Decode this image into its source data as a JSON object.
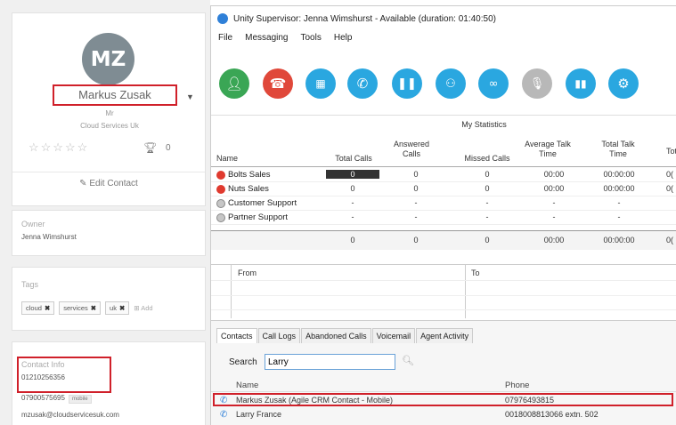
{
  "crm": {
    "avatar_initials": "MZ",
    "contact_name": "Markus Zusak",
    "salutation": "Mr",
    "company": "Cloud Services Uk",
    "stars": "☆☆☆☆☆",
    "score": "0",
    "edit_label": "Edit Contact",
    "owner_label": "Owner",
    "owner_value": "Jenna Wimshurst",
    "tags_label": "Tags",
    "tags": [
      "cloud",
      "services",
      "uk"
    ],
    "tag_add": "Add",
    "contact_info_label": "Contact Info",
    "phone1": "01210256356",
    "phone2": "07900575695",
    "phone2_badge": "mobile",
    "email": "mzusak@cloudservicesuk.com"
  },
  "unity": {
    "title": "Unity Supervisor: Jenna Wimshurst - Available (duration: 01:40:50)",
    "menu": [
      "File",
      "Messaging",
      "Tools",
      "Help"
    ],
    "toolbar_buttons": [
      {
        "name": "agent-status-icon",
        "color": "#3aa655"
      },
      {
        "name": "hangup-icon",
        "color": "#e0483a"
      },
      {
        "name": "dialpad-icon",
        "color": "#2aa7e0"
      },
      {
        "name": "transfer-call-icon",
        "color": "#2aa7e0"
      },
      {
        "name": "pause-icon",
        "color": "#2aa7e0"
      },
      {
        "name": "conference-icon",
        "color": "#2aa7e0"
      },
      {
        "name": "voicemail-icon",
        "color": "#2aa7e0"
      },
      {
        "name": "microphone-icon",
        "color": "#b8b8b8"
      },
      {
        "name": "statistics-icon",
        "color": "#2aa7e0"
      },
      {
        "name": "settings-icon",
        "color": "#2aa7e0"
      }
    ],
    "stats": {
      "title": "My Statistics",
      "columns": [
        "Name",
        "Total Calls",
        "Answered Calls",
        "Missed Calls",
        "Average Talk Time",
        "Total Talk Time",
        "Tot"
      ],
      "rows": [
        {
          "name": "Bolts Sales",
          "status": "red",
          "total": "0",
          "answered": "0",
          "missed": "0",
          "avg": "00:00",
          "talk": "00:00:00",
          "tot": "0("
        },
        {
          "name": "Nuts Sales",
          "status": "red",
          "total": "0",
          "answered": "0",
          "missed": "0",
          "avg": "00:00",
          "talk": "00:00:00",
          "tot": "0("
        },
        {
          "name": "Customer Support",
          "status": "grey",
          "total": "-",
          "answered": "-",
          "missed": "-",
          "avg": "-",
          "talk": "-",
          "tot": ""
        },
        {
          "name": "Partner Support",
          "status": "grey",
          "total": "-",
          "answered": "-",
          "missed": "-",
          "avg": "-",
          "talk": "-",
          "tot": ""
        }
      ],
      "totals": {
        "total": "0",
        "answered": "0",
        "missed": "0",
        "avg": "00:00",
        "talk": "00:00:00",
        "tot": "0("
      }
    },
    "from_label": "From",
    "to_label": "To",
    "tabs": [
      "Contacts",
      "Call Logs",
      "Abandoned Calls",
      "Voicemail",
      "Agent Activity"
    ],
    "search_label": "Search",
    "search_value": "Larry",
    "results_headers": {
      "name": "Name",
      "phone": "Phone"
    },
    "results": [
      {
        "name": "Markus Zusak (Agile CRM Contact - Mobile)",
        "phone": "07976493815"
      },
      {
        "name": "Larry France",
        "phone": "0018008813066 extn. 502"
      }
    ]
  }
}
